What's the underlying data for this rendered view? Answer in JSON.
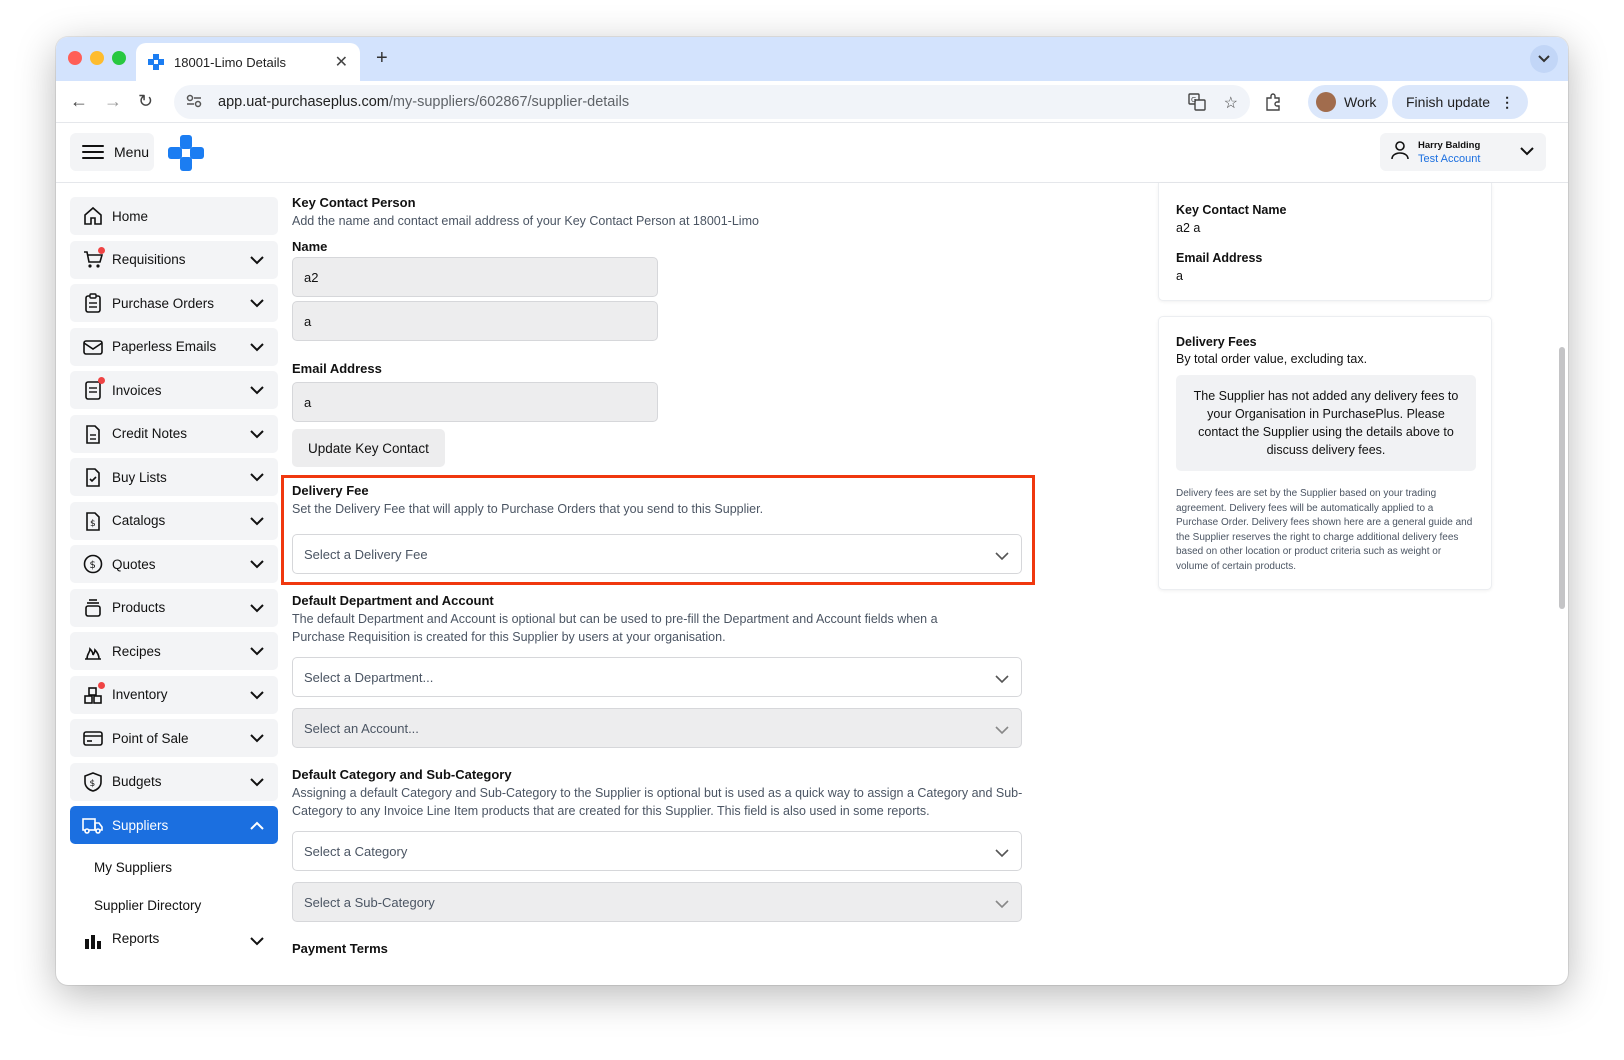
{
  "browser": {
    "tab_title": "18001-Limo Details",
    "url_domain": "app.uat-purchaseplus.com",
    "url_path": "/my-suppliers/602867/supplier-details",
    "profile_label": "Work",
    "finish_update_label": "Finish update"
  },
  "header": {
    "menu_label": "Menu",
    "user_name": "Harry Balding",
    "user_account": "Test Account"
  },
  "sidebar": {
    "items": [
      {
        "label": "Home",
        "icon": "home-icon"
      },
      {
        "label": "Requisitions",
        "icon": "cart-icon"
      },
      {
        "label": "Purchase Orders",
        "icon": "clipboard-icon"
      },
      {
        "label": "Paperless Emails",
        "icon": "envelope-icon"
      },
      {
        "label": "Invoices",
        "icon": "invoice-icon"
      },
      {
        "label": "Credit Notes",
        "icon": "document-icon"
      },
      {
        "label": "Buy Lists",
        "icon": "checklist-icon"
      },
      {
        "label": "Catalogs",
        "icon": "dollar-document-icon"
      },
      {
        "label": "Quotes",
        "icon": "dollar-circle-icon"
      },
      {
        "label": "Products",
        "icon": "stack-icon"
      },
      {
        "label": "Recipes",
        "icon": "flame-icon"
      },
      {
        "label": "Inventory",
        "icon": "boxes-icon"
      },
      {
        "label": "Point of Sale",
        "icon": "card-icon"
      },
      {
        "label": "Budgets",
        "icon": "shield-dollar-icon"
      },
      {
        "label": "Suppliers",
        "icon": "truck-icon"
      }
    ],
    "sub_items": [
      "My Suppliers",
      "Supplier Directory"
    ],
    "reports_label": "Reports"
  },
  "key_contact": {
    "title": "Key Contact Person",
    "description": "Add the name and contact email address of your Key Contact Person at 18001-Limo",
    "name_label": "Name",
    "first_name": "a2",
    "last_name": "a",
    "email_label": "Email Address",
    "email": "a",
    "update_button": "Update Key Contact"
  },
  "delivery_fee": {
    "title": "Delivery Fee",
    "description": "Set the Delivery Fee that will apply to Purchase Orders that you send to this Supplier.",
    "select_placeholder": "Select a Delivery Fee"
  },
  "default_department": {
    "title": "Default Department and Account",
    "description": "The default Department and Account is optional but can be used to pre-fill the Department and Account fields when a Purchase Requisition is created for this Supplier by users at your organisation.",
    "department_placeholder": "Select a Department...",
    "account_placeholder": "Select an Account..."
  },
  "default_category": {
    "title": "Default Category and Sub-Category",
    "description": "Assigning a default Category and Sub-Category to the Supplier is optional but is used as a quick way to assign a Category and Sub-Category to any Invoice Line Item products that are created for this Supplier. This field is also used in some reports.",
    "category_placeholder": "Select a Category",
    "subcategory_placeholder": "Select a Sub-Category"
  },
  "payment_terms": {
    "title": "Payment Terms"
  },
  "right_panel": {
    "contact": {
      "name_label": "Key Contact Name",
      "name_value": "a2 a",
      "email_label": "Email Address",
      "email_value": "a"
    },
    "delivery_fees": {
      "title": "Delivery Fees",
      "subtitle": "By total order value, excluding tax.",
      "notice": "The Supplier has not added any delivery fees to your Organisation in PurchasePlus. Please contact the Supplier using the details above to discuss delivery fees.",
      "footnote": "Delivery fees are set by the Supplier based on your trading agreement. Delivery fees will be automatically applied to a Purchase Order. Delivery fees shown here are a general guide and the Supplier reserves the right to charge additional delivery fees based on other location or product criteria such as weight or volume of certain products."
    }
  },
  "colors": {
    "brand": "#1b6fe0",
    "highlight": "#f0380f",
    "notification": "#ef4444"
  }
}
